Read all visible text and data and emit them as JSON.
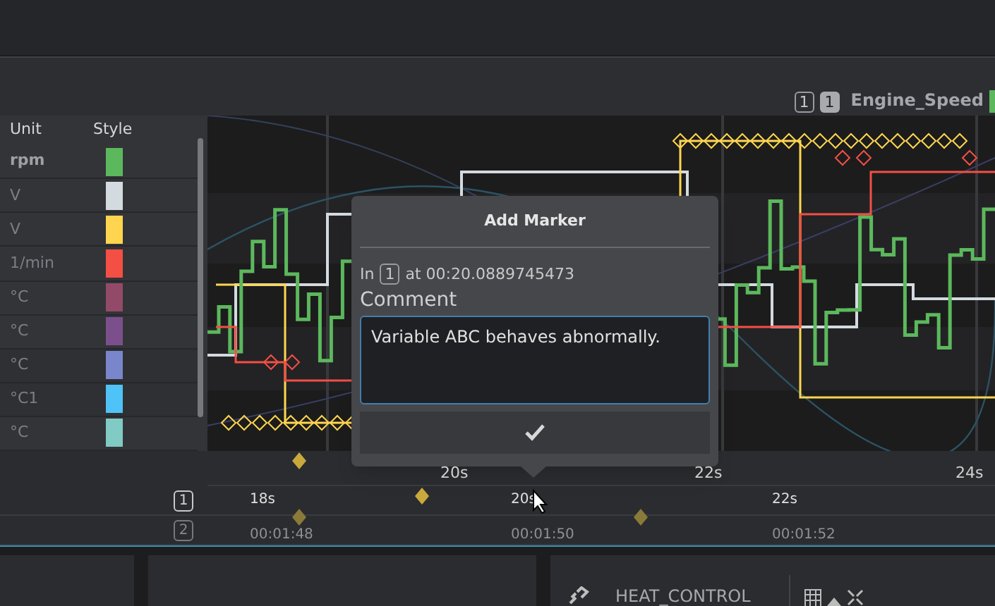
{
  "legend": {
    "pane_badge": "1",
    "signal_badge": "1",
    "signal": "Engine_Speed",
    "color": "#5cb85c"
  },
  "table": {
    "columns": [
      "Unit",
      "Style"
    ],
    "rows": [
      {
        "unit": "rpm",
        "color": "#5cb85c",
        "selected": true
      },
      {
        "unit": "V",
        "color": "#d3dae0",
        "selected": false
      },
      {
        "unit": "V",
        "color": "#ffd54f",
        "selected": false
      },
      {
        "unit": "1/min",
        "color": "#f44f44",
        "selected": false
      },
      {
        "unit": "°C",
        "color": "#934a68",
        "selected": false
      },
      {
        "unit": "°C",
        "color": "#7b4f8c",
        "selected": false
      },
      {
        "unit": "°C",
        "color": "#7986cb",
        "selected": false
      },
      {
        "unit": "°C1",
        "color": "#4fc3f7",
        "selected": false
      },
      {
        "unit": "°C",
        "color": "#80cbc4",
        "selected": false
      }
    ]
  },
  "axis": {
    "ticks": [
      "20s",
      "22s",
      "24s"
    ]
  },
  "timelines": [
    {
      "badge": "1",
      "labels": [
        "18s",
        "20s",
        "22s"
      ]
    },
    {
      "badge": "2",
      "labels": [
        "00:01:48",
        "00:01:50",
        "00:01:52"
      ]
    }
  ],
  "dialog": {
    "title": "Add Marker",
    "prefix": "In",
    "badge": "1",
    "timestamp": "at 00:20.0889745473",
    "comment_label": "Comment",
    "comment": "Variable ABC behaves abnormally."
  },
  "bottom": {
    "panel_title": "HEAT_CONTROL"
  }
}
